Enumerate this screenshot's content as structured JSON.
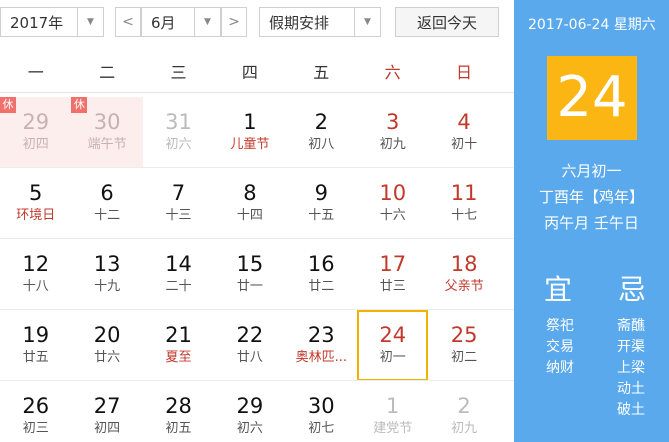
{
  "toolbar": {
    "year": "2017年",
    "month": "6月",
    "holiday": "假期安排",
    "today": "返回今天",
    "prev": "<",
    "next": ">",
    "dropdown": "▼"
  },
  "weekdays": [
    "一",
    "二",
    "三",
    "四",
    "五",
    "六",
    "日"
  ],
  "weeks": [
    [
      {
        "num": "29",
        "sub": "初四",
        "kind": "rest",
        "badge": "休"
      },
      {
        "num": "30",
        "sub": "端午节",
        "kind": "rest",
        "badge": "休"
      },
      {
        "num": "31",
        "sub": "初六",
        "kind": "other"
      },
      {
        "num": "1",
        "sub": "儿童节",
        "kind": "fest"
      },
      {
        "num": "2",
        "sub": "初八",
        "kind": ""
      },
      {
        "num": "3",
        "sub": "初九",
        "kind": "we"
      },
      {
        "num": "4",
        "sub": "初十",
        "kind": "we"
      }
    ],
    [
      {
        "num": "5",
        "sub": "环境日",
        "kind": "fest"
      },
      {
        "num": "6",
        "sub": "十二",
        "kind": ""
      },
      {
        "num": "7",
        "sub": "十三",
        "kind": ""
      },
      {
        "num": "8",
        "sub": "十四",
        "kind": ""
      },
      {
        "num": "9",
        "sub": "十五",
        "kind": ""
      },
      {
        "num": "10",
        "sub": "十六",
        "kind": "we"
      },
      {
        "num": "11",
        "sub": "十七",
        "kind": "we"
      }
    ],
    [
      {
        "num": "12",
        "sub": "十八",
        "kind": ""
      },
      {
        "num": "13",
        "sub": "十九",
        "kind": ""
      },
      {
        "num": "14",
        "sub": "二十",
        "kind": ""
      },
      {
        "num": "15",
        "sub": "廿一",
        "kind": ""
      },
      {
        "num": "16",
        "sub": "廿二",
        "kind": ""
      },
      {
        "num": "17",
        "sub": "廿三",
        "kind": "we"
      },
      {
        "num": "18",
        "sub": "父亲节",
        "kind": "we fest"
      }
    ],
    [
      {
        "num": "19",
        "sub": "廿五",
        "kind": ""
      },
      {
        "num": "20",
        "sub": "廿六",
        "kind": ""
      },
      {
        "num": "21",
        "sub": "夏至",
        "kind": "fest"
      },
      {
        "num": "22",
        "sub": "廿八",
        "kind": ""
      },
      {
        "num": "23",
        "sub": "奥林匹...",
        "kind": "fest"
      },
      {
        "num": "24",
        "sub": "初一",
        "kind": "we sel"
      },
      {
        "num": "25",
        "sub": "初二",
        "kind": "we"
      }
    ],
    [
      {
        "num": "26",
        "sub": "初三",
        "kind": ""
      },
      {
        "num": "27",
        "sub": "初四",
        "kind": ""
      },
      {
        "num": "28",
        "sub": "初五",
        "kind": ""
      },
      {
        "num": "29",
        "sub": "初六",
        "kind": ""
      },
      {
        "num": "30",
        "sub": "初七",
        "kind": ""
      },
      {
        "num": "1",
        "sub": "建党节",
        "kind": "other"
      },
      {
        "num": "2",
        "sub": "初九",
        "kind": "other"
      }
    ]
  ],
  "panel": {
    "date": "2017-06-24 星期六",
    "day": "24",
    "lunar": "六月初一",
    "year_gz": "丁酉年【鸡年】",
    "month_day_gz": "丙午月 壬午日",
    "yi": "宜",
    "ji": "忌",
    "yi_items": [
      "祭祀",
      "交易",
      "纳财"
    ],
    "ji_items": [
      "斋醮",
      "开渠",
      "上梁",
      "动土",
      "破土"
    ]
  },
  "colors": {
    "accent": "#5aa9ec",
    "today_box": "#fbb613",
    "selected_border": "#f0b400",
    "festival_red": "#c0392b",
    "rest_bg": "#fdeeee"
  }
}
